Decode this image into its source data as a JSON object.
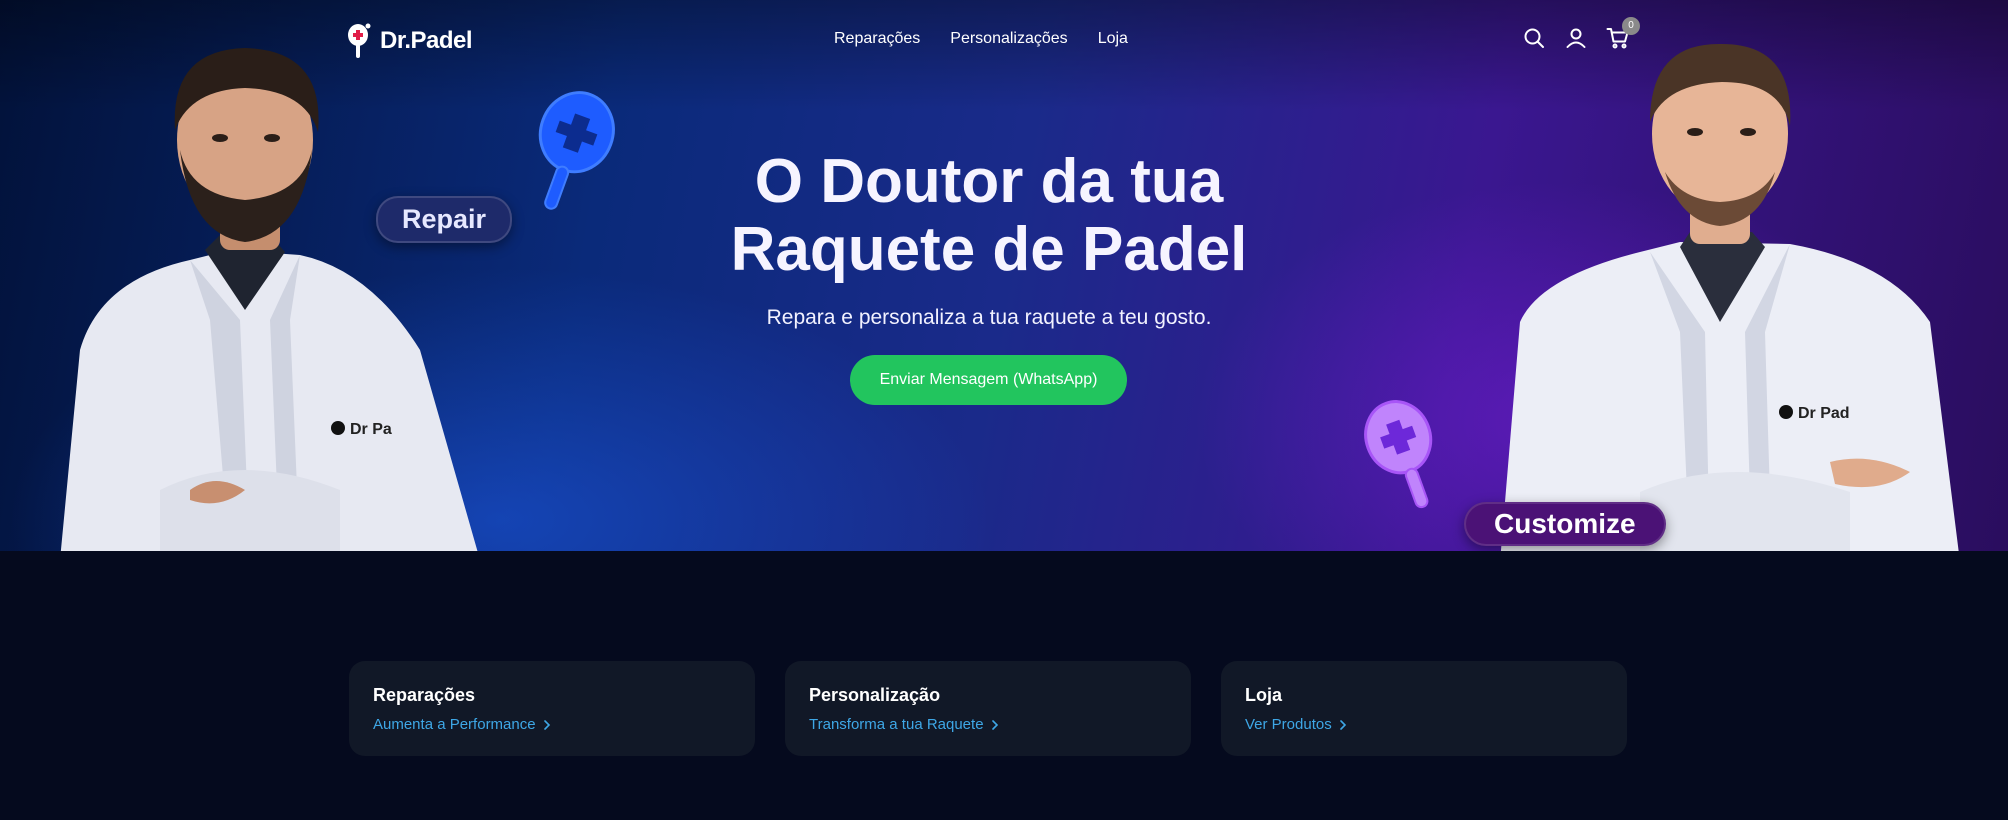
{
  "brand": {
    "name": "Dr.Padel"
  },
  "nav": {
    "items": [
      {
        "label": "Reparações"
      },
      {
        "label": "Personalizações"
      },
      {
        "label": "Loja"
      }
    ]
  },
  "header_icons": {
    "search": "search-icon",
    "account": "user-icon",
    "cart": "cart-icon",
    "cart_count": "0"
  },
  "hero": {
    "title_line1": "O Doutor da tua",
    "title_line2": "Raquete de Padel",
    "subtitle": "Repara e personaliza a tua raquete a teu gosto.",
    "cta_label": "Enviar Mensagem (WhatsApp)",
    "tag_left": "Repair",
    "tag_right": "Customize",
    "coat_logo_left": "Dr Pa",
    "coat_logo_right": "Dr Pad"
  },
  "cards": [
    {
      "title": "Reparações",
      "link": "Aumenta a Performance"
    },
    {
      "title": "Personalização",
      "link": "Transforma a tua Raquete"
    },
    {
      "title": "Loja",
      "link": "Ver Produtos"
    }
  ],
  "colors": {
    "page_bg": "#050a1e",
    "card_bg": "#111827",
    "cta": "#22c55e",
    "link": "#3ea7e6",
    "hero_blue": "#0a2a7a",
    "hero_purple": "#3a1790"
  }
}
